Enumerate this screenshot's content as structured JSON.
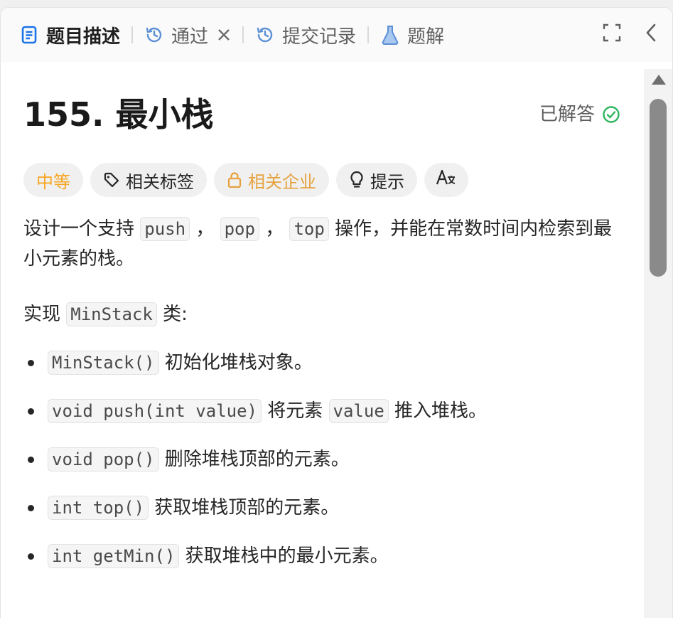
{
  "tabs": [
    {
      "label": "题目描述",
      "icon": "document-icon"
    },
    {
      "label": "通过",
      "icon": "history-icon"
    },
    {
      "label": "提交记录",
      "icon": "history-icon"
    },
    {
      "label": "题解",
      "icon": "flask-icon"
    }
  ],
  "problem": {
    "title": "155. 最小栈",
    "status": "已解答"
  },
  "tags": {
    "difficulty": "中等",
    "related_tags": "相关标签",
    "companies": "相关企业",
    "hint": "提示"
  },
  "desc": {
    "p1_a": "设计一个支持 ",
    "code_push": "push",
    "sep1": " ， ",
    "code_pop": "pop",
    "sep2": " ， ",
    "code_top": "top",
    "p1_b": " 操作，并能在常数时间内检索到最小元素的栈。",
    "p2_a": "实现 ",
    "code_minstack": "MinStack",
    "p2_b": " 类:"
  },
  "methods": [
    {
      "code": "MinStack()",
      "text": " 初始化堆栈对象。"
    },
    {
      "code": "void push(int value)",
      "text_a": " 将元素 ",
      "code2": "value",
      "text_b": " 推入堆栈。"
    },
    {
      "code": "void pop()",
      "text": " 删除堆栈顶部的元素。"
    },
    {
      "code": "int top()",
      "text": " 获取堆栈顶部的元素。"
    },
    {
      "code": "int getMin()",
      "text": " 获取堆栈中的最小元素。"
    }
  ],
  "colors": {
    "accent_blue": "#1a73e8",
    "solved_green": "#2db55d",
    "difficulty": "#f5a623"
  }
}
